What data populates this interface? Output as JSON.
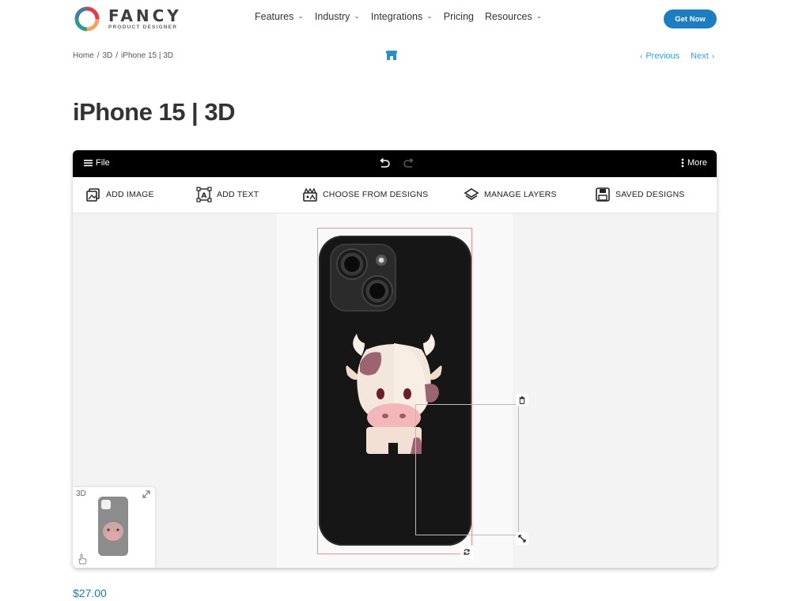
{
  "brand": {
    "name": "FANCY",
    "tagline": "PRODUCT DESIGNER"
  },
  "nav": {
    "items": [
      {
        "label": "Features",
        "has_dropdown": true
      },
      {
        "label": "Industry",
        "has_dropdown": true
      },
      {
        "label": "Integrations",
        "has_dropdown": true
      },
      {
        "label": "Pricing",
        "has_dropdown": false
      },
      {
        "label": "Resources",
        "has_dropdown": true
      }
    ],
    "cta_label": "Get Now"
  },
  "breadcrumb": {
    "items": [
      "Home",
      "3D",
      "iPhone 15 | 3D"
    ],
    "separator": "/"
  },
  "pager": {
    "previous_label": "Previous",
    "next_label": "Next"
  },
  "product": {
    "title": "iPhone 15 | 3D",
    "price": "$27.00"
  },
  "designer": {
    "topbar": {
      "file_label": "File",
      "more_label": "More"
    },
    "actions": [
      {
        "label": "ADD IMAGE",
        "icon": "image-icon"
      },
      {
        "label": "ADD TEXT",
        "icon": "text-icon"
      },
      {
        "label": "CHOOSE FROM DESIGNS",
        "icon": "designs-icon"
      },
      {
        "label": "MANAGE LAYERS",
        "icon": "layers-icon"
      },
      {
        "label": "SAVED DESIGNS",
        "icon": "save-icon"
      }
    ],
    "preview": {
      "label": "3D"
    }
  },
  "colors": {
    "accent": "#1c7ec1",
    "link": "#3ba0d8",
    "price": "#1f78b4",
    "toolbar_bg": "#000000",
    "phone_case": "#161616",
    "bounding_box": "#e8909b"
  }
}
